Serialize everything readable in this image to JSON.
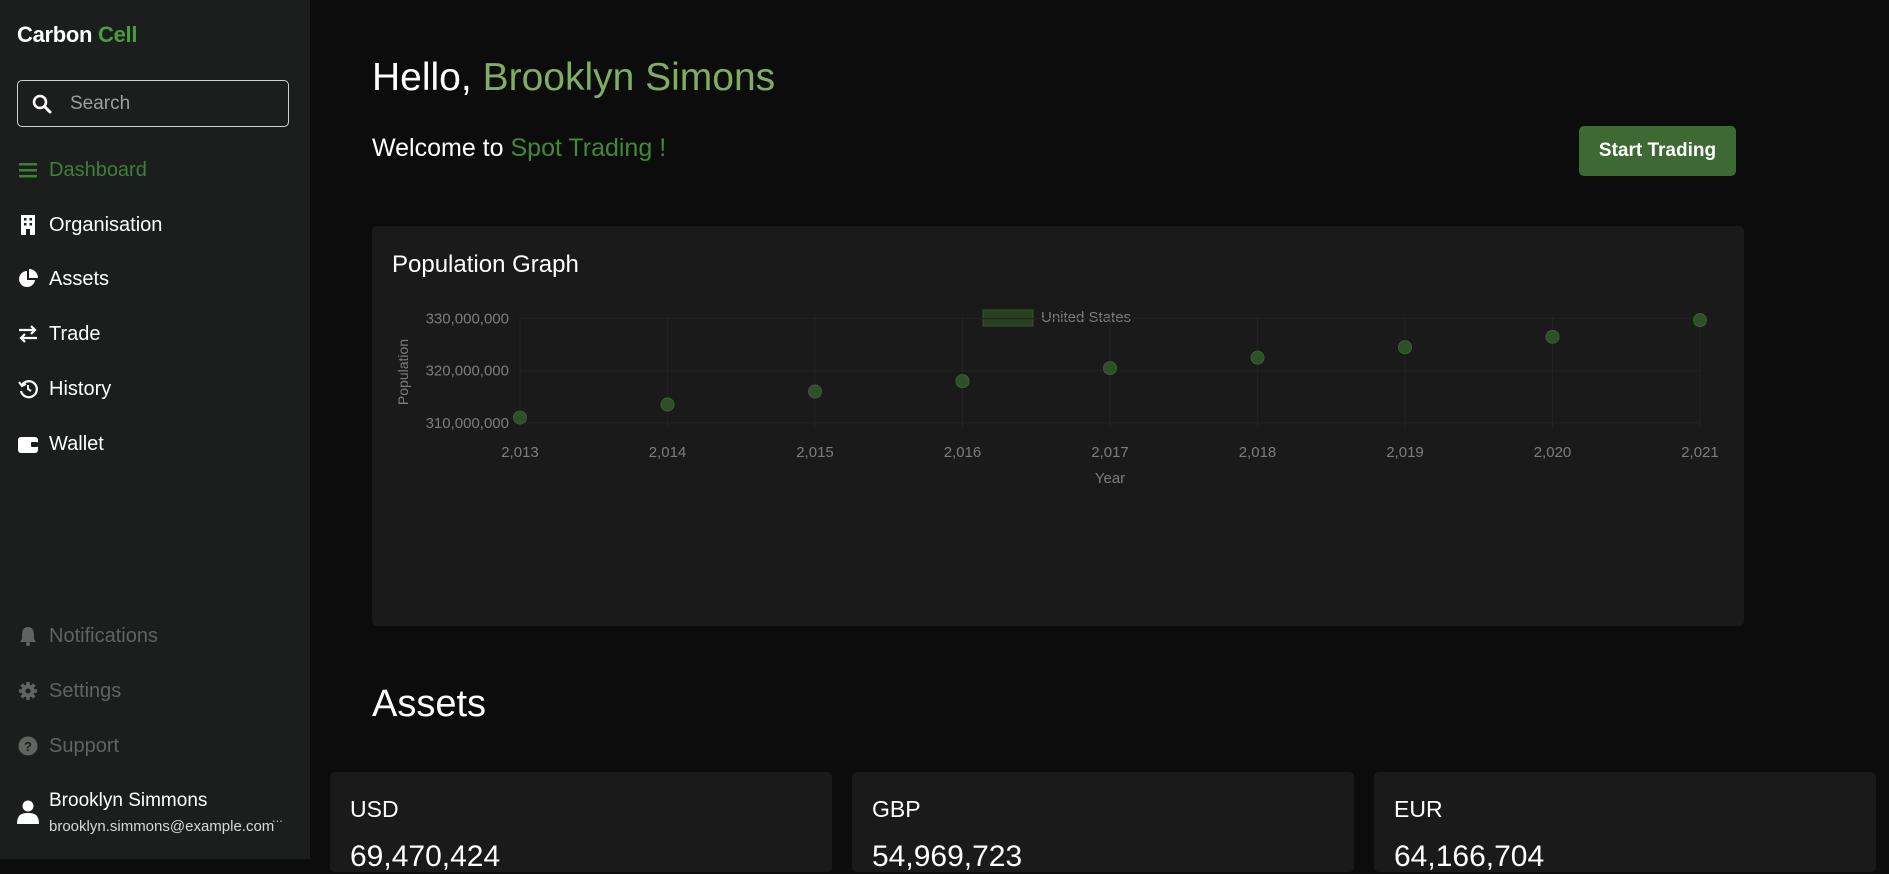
{
  "brand": {
    "part1": "Carbon",
    "part2": "Cell"
  },
  "search": {
    "placeholder": "Search"
  },
  "nav": {
    "dashboard": "Dashboard",
    "organisation": "Organisation",
    "assets": "Assets",
    "trade": "Trade",
    "history": "History",
    "wallet": "Wallet",
    "notifications": "Notifications",
    "settings": "Settings",
    "support": "Support"
  },
  "user": {
    "name": "Brooklyn Simmons",
    "email": "brooklyn.simmons@example.com",
    "more": "..."
  },
  "header": {
    "hello": "Hello,",
    "hello_name": "Brooklyn Simons",
    "welcome": "Welcome to",
    "welcome_accent": "Spot Trading !",
    "start_trading": "Start Trading"
  },
  "graph": {
    "title": "Population Graph"
  },
  "chart_data": {
    "type": "scatter",
    "title": "",
    "legend": "United States",
    "legend_placement": "top-center",
    "xlabel": "Year",
    "ylabel": "Population",
    "x": [
      2013,
      2014,
      2015,
      2016,
      2017,
      2018,
      2019,
      2020,
      2021
    ],
    "x_tick_labels": [
      "2,013",
      "2,014",
      "2,015",
      "2,016",
      "2,017",
      "2,018",
      "2,019",
      "2,020",
      "2,021"
    ],
    "y_tick_labels": [
      "330,000,000",
      "320,000,000",
      "310,000,000"
    ],
    "y_ticks": [
      330000000,
      320000000,
      310000000
    ],
    "ylim": [
      309000000,
      330500000
    ],
    "series": [
      {
        "name": "United States",
        "values": [
          311000000,
          313500000,
          316000000,
          318000000,
          320500000,
          322500000,
          324500000,
          326500000,
          329700000
        ]
      }
    ],
    "grid": true,
    "point_color": "#2f4f2a"
  },
  "assets": {
    "title": "Assets",
    "cards": [
      {
        "currency": "USD",
        "value": "69,470,424"
      },
      {
        "currency": "GBP",
        "value": "54,969,723"
      },
      {
        "currency": "EUR",
        "value": "64,166,704"
      }
    ]
  },
  "colors": {
    "accent": "#4e9a44",
    "button": "#3c6a32",
    "sidebar": "#1c1e1d",
    "card": "#1a1a1a",
    "background": "#0c0c0c"
  }
}
